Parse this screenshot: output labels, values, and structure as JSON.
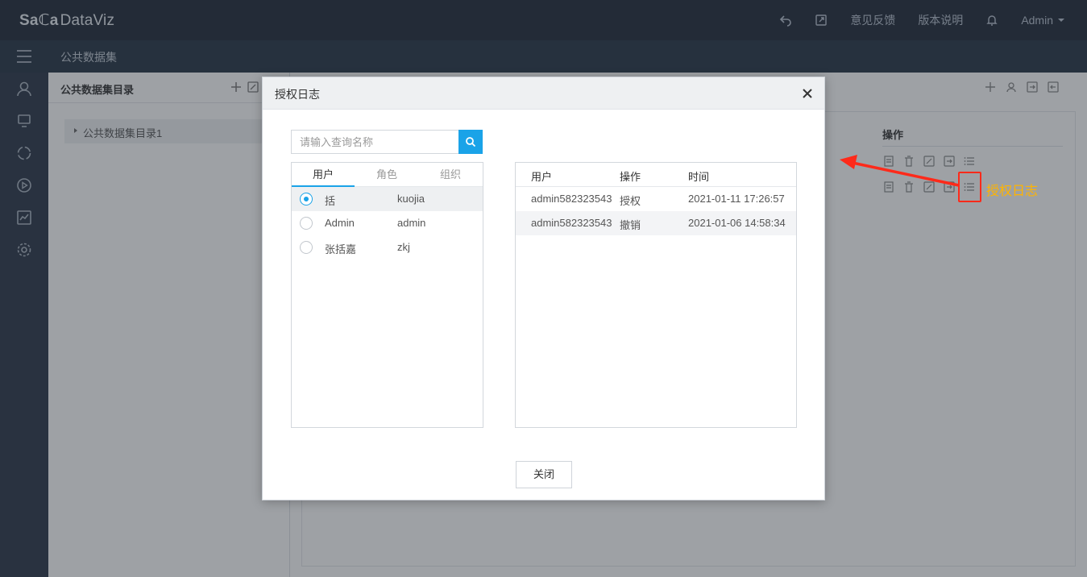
{
  "app": {
    "logo_a": "Sa",
    "logo_b": "ℂa",
    "logo_c": "DataViz",
    "topnav": {
      "feedback": "意见反馈",
      "release_notes": "版本说明",
      "user": "Admin"
    },
    "breadcrumb": "公共数据集",
    "rail_icons": [
      "user-icon",
      "monitor-icon",
      "cycle-icon",
      "play-icon",
      "chart-icon",
      "gear-icon"
    ]
  },
  "left_panel": {
    "title": "公共数据集目录",
    "tree": [
      {
        "label": "公共数据集目录1"
      }
    ]
  },
  "right_panel": {
    "operations_header": "操作"
  },
  "annotation": {
    "label": "授权日志",
    "color": "#ff2a1a",
    "text_color": "#ffb400"
  },
  "modal": {
    "title": "授权日志",
    "search_placeholder": "请输入查询名称",
    "tabs": [
      "用户",
      "角色",
      "组织"
    ],
    "active_tab": "用户",
    "users": [
      {
        "name": "括",
        "login": "kuojia",
        "selected": true
      },
      {
        "name": "Admin",
        "login": "admin",
        "selected": false
      },
      {
        "name": "张括嘉",
        "login": "zkj",
        "selected": false
      }
    ],
    "log_columns": [
      "用户",
      "操作",
      "时间"
    ],
    "logs": [
      {
        "user": "admin582323543",
        "action": "授权",
        "time": "2021-01-11 17:26:57"
      },
      {
        "user": "admin582323543",
        "action": "撤销",
        "time": "2021-01-06 14:58:34"
      }
    ],
    "close_button": "关闭",
    "accent": "#1aa3e8"
  }
}
